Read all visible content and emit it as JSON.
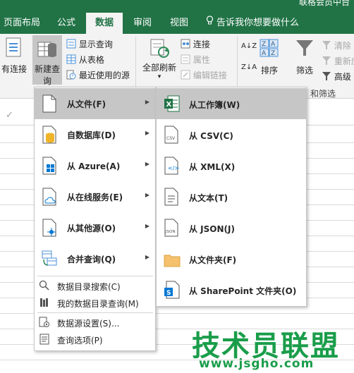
{
  "window": {
    "title": "联格会员中台"
  },
  "tabs": [
    {
      "label": "页面布局",
      "active": false
    },
    {
      "label": "公式",
      "active": false
    },
    {
      "label": "数据",
      "active": true
    },
    {
      "label": "审阅",
      "active": false
    },
    {
      "label": "视图",
      "active": false
    }
  ],
  "tell_me": "告诉我你想要做什么",
  "ribbon": {
    "existing_connections": "有连接",
    "new_query": "新建查询",
    "new_query_arrow": "▾",
    "show_queries": "显示查询",
    "from_table": "从表格",
    "recent_sources": "最近使用的源",
    "refresh_all": "全部刷新",
    "refresh_arrow": "▾",
    "connections": "连接",
    "properties": "属性",
    "edit_links": "编辑链接",
    "sort_az": "A↓Z",
    "sort_za": "Z↓A",
    "sort": "排序",
    "filter": "筛选",
    "clear": "清除",
    "reapply": "重新应用",
    "advanced": "高级",
    "sort_filter_group": "和筛选"
  },
  "formula_bar": {
    "check": "✓"
  },
  "menu_new_query": {
    "items": [
      {
        "label": "从文件(F)",
        "has_submenu": true,
        "highlighted": true
      },
      {
        "label": "自数据库(D)",
        "has_submenu": true,
        "highlighted": false
      },
      {
        "label": "从 Azure(A)",
        "has_submenu": true,
        "highlighted": false
      },
      {
        "label": "从在线服务(E)",
        "has_submenu": true,
        "highlighted": false
      },
      {
        "label": "从其他源(O)",
        "has_submenu": true,
        "highlighted": false
      },
      {
        "label": "合并查询(Q)",
        "has_submenu": true,
        "highlighted": false
      }
    ],
    "small_items": [
      {
        "label": "数据目录搜索(C)"
      },
      {
        "label": "我的数据目录查询(M)"
      },
      {
        "label": "数据源设置(S)..."
      },
      {
        "label": "查询选项(P)"
      }
    ],
    "arrow": "▶"
  },
  "menu_from_file": {
    "items": [
      {
        "label": "从工作簿(W)",
        "highlighted": true,
        "icon": "excel-workbook-icon"
      },
      {
        "label": "从 CSV(C)",
        "highlighted": false,
        "icon": "csv-file-icon"
      },
      {
        "label": "从 XML(X)",
        "highlighted": false,
        "icon": "xml-file-icon"
      },
      {
        "label": "从文本(T)",
        "highlighted": false,
        "icon": "text-file-icon"
      },
      {
        "label": "从 JSON(J)",
        "highlighted": false,
        "icon": "json-file-icon"
      },
      {
        "label": "从文件夹(F)",
        "highlighted": false,
        "icon": "folder-icon"
      },
      {
        "label": "从 SharePoint 文件夹(O)",
        "highlighted": false,
        "icon": "sharepoint-folder-icon"
      }
    ]
  },
  "watermark": {
    "text": "技术员联盟",
    "url": "www.jsgho.com"
  },
  "colors": {
    "brand": "#217346",
    "menu_highlight": "#c6c6c6",
    "watermark": "#1a9d4a"
  }
}
